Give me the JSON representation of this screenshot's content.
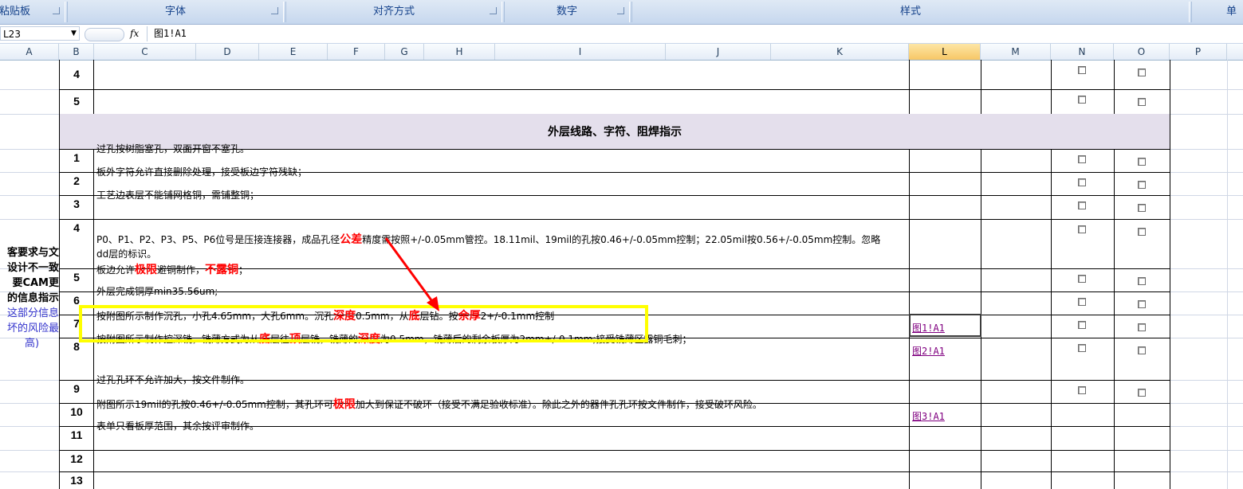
{
  "ribbon": {
    "groups": [
      "粘贴板",
      "字体",
      "对齐方式",
      "数字",
      "样式",
      "单"
    ]
  },
  "formula_bar": {
    "name_box": "L23",
    "fx_label": "fx",
    "formula": "图1!A1"
  },
  "columns": [
    "A",
    "B",
    "C",
    "D",
    "E",
    "F",
    "G",
    "H",
    "I",
    "J",
    "K",
    "L",
    "M",
    "N",
    "O",
    "P"
  ],
  "selected_column": "L",
  "side_note": {
    "black_lines": [
      "客要求与文",
      "设计不一致",
      "要CAM更",
      "的信息指示"
    ],
    "blue_lines": [
      "这部分信息",
      "坏的风险最",
      "高)"
    ]
  },
  "top_rows": [
    "4",
    "5"
  ],
  "section_header": "外层线路、字符、阻焊指示",
  "items": [
    {
      "num": "1",
      "parts": [
        [
          "过孔按树脂塞孔，双面开窗不塞孔。",
          false
        ]
      ]
    },
    {
      "num": "2",
      "parts": [
        [
          "板外字符允许直接删除处理，接受板边字符残缺；",
          false
        ]
      ]
    },
    {
      "num": "3",
      "parts": [
        [
          "工艺边表层不能铺网格铜，需铺整铜；",
          false
        ]
      ]
    },
    {
      "num": "4",
      "parts": [
        [
          "P0、P1、P2、P3、P5、P6位号是压接连接器，成品孔径",
          false
        ],
        [
          "公差",
          true
        ],
        [
          "精度需按照+/-0.05mm管控。18.11mil、19mil的孔按0.46+/-0.05mm控制；22.05mil按0.56+/-0.05mm控制。忽略",
          false
        ]
      ],
      "line2": "dd层的标识。"
    },
    {
      "num": "5",
      "parts": [
        [
          "板边允许",
          false
        ],
        [
          "极限",
          true
        ],
        [
          "避铜制作，",
          false
        ],
        [
          "不露铜",
          true
        ],
        [
          "；",
          false
        ]
      ]
    },
    {
      "num": "6",
      "parts": [
        [
          "外层完成铜厚min35.56um;",
          false
        ]
      ]
    },
    {
      "num": "7",
      "parts": [
        [
          "按附图所示制作沉孔，小孔4.65mm，大孔6mm。沉孔",
          false
        ],
        [
          "深度",
          true
        ],
        [
          "0.5mm，从",
          false
        ],
        [
          "底",
          true
        ],
        [
          "层钻。按",
          false
        ],
        [
          "余厚",
          true
        ],
        [
          "2+/-0.1mm控制",
          false
        ]
      ],
      "link": "图1!A1"
    },
    {
      "num": "8",
      "parts": [
        [
          "按附图所示制作控深铣，铣薄方式为从",
          false
        ],
        [
          "底",
          true
        ],
        [
          "层往",
          false
        ],
        [
          "顶",
          true
        ],
        [
          "层铣，铣薄的",
          false
        ],
        [
          "深度",
          true
        ],
        [
          "为0.5mm，铣薄后的剩余板厚为2mm+/-0.1mm;接受铣薄区露铜毛刺；",
          false
        ]
      ],
      "link": "图2!A1"
    },
    {
      "num": "9",
      "parts": [
        [
          "过孔孔环不允许加大，按文件制作。",
          false
        ]
      ]
    },
    {
      "num": "10",
      "parts": [
        [
          "附图所示19mil的孔按0.46+/-0.05mm控制，其孔环可",
          false
        ],
        [
          "极限",
          true
        ],
        [
          "加大到保证不破环（接受不满足验收标准）。除此之外的器件孔孔环按文件制作，接受破环风险。",
          false
        ]
      ],
      "link": "图3!A1"
    },
    {
      "num": "11",
      "parts": [
        [
          "表单只看板厚范围，其余按评审制作。",
          false
        ]
      ]
    },
    {
      "num": "12",
      "parts": []
    },
    {
      "num": "13",
      "parts": []
    }
  ],
  "colors": {
    "header_fill": "#e4dfec",
    "link_fill": "#92d050",
    "annotation_box": "#ffff00",
    "arrow": "#ff0000",
    "emphasis": "#ff0000",
    "side_note_blue": "#3333cc"
  }
}
